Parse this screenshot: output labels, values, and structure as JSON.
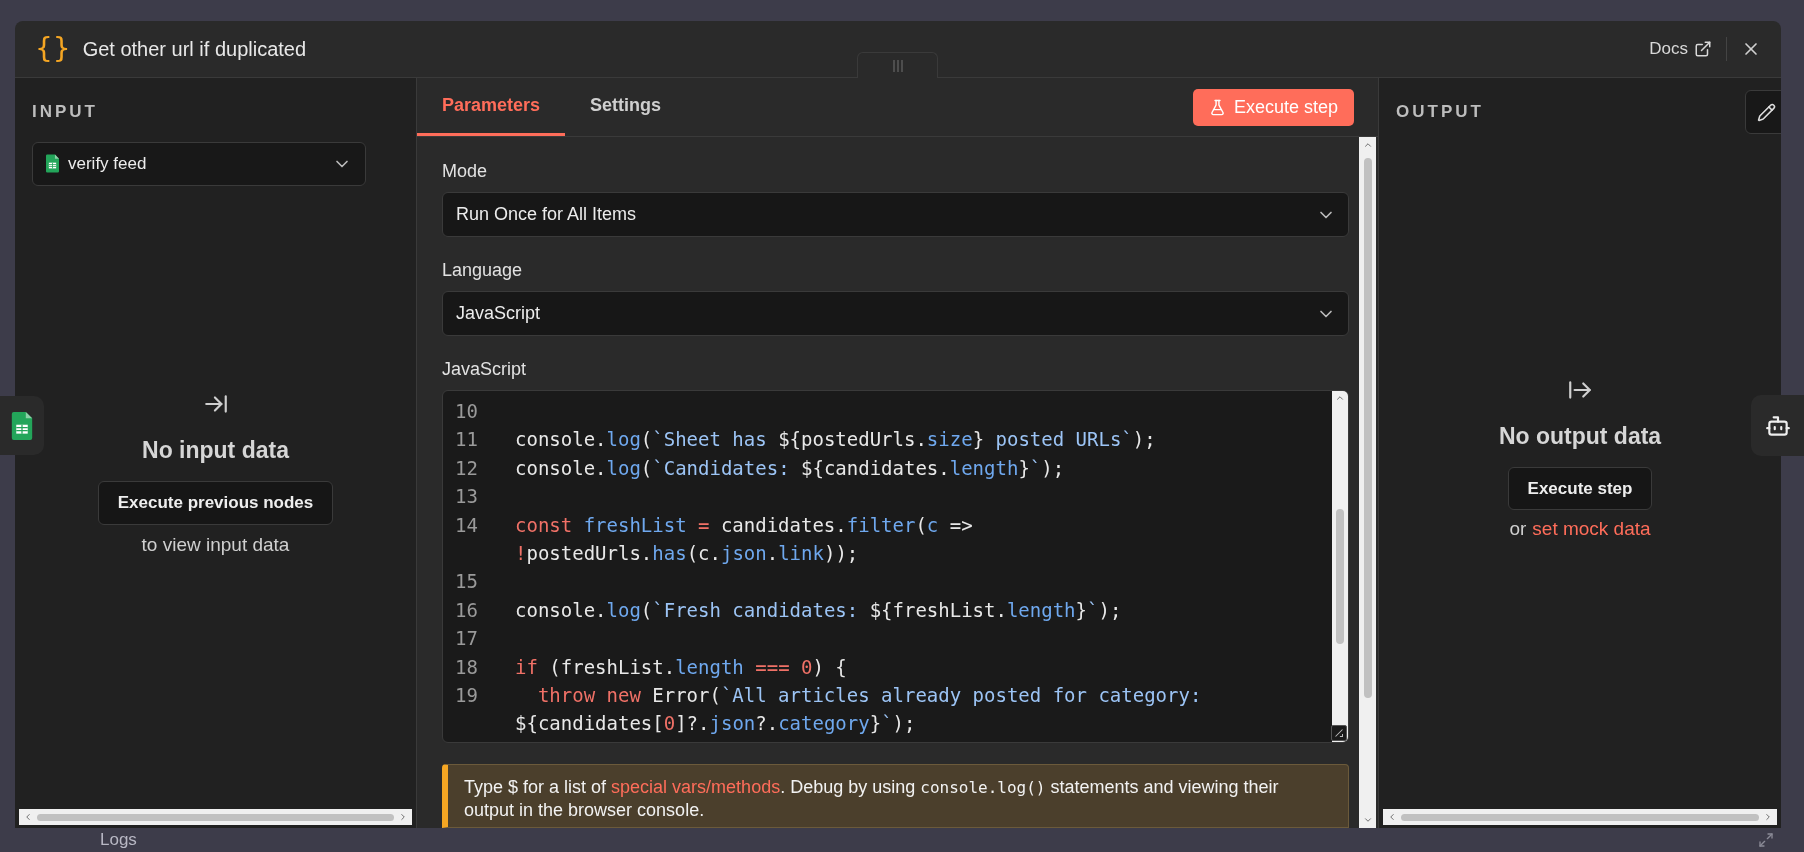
{
  "window": {
    "icon_text": "{}",
    "title": "Get other url if duplicated",
    "docs": "Docs"
  },
  "input": {
    "heading": "INPUT",
    "source": "verify feed",
    "empty_title": "No input data",
    "button": "Execute previous nodes",
    "hint": "to view input data"
  },
  "tabs": [
    {
      "label": "Parameters",
      "selected": true
    },
    {
      "label": "Settings",
      "selected": false
    }
  ],
  "execute_button": "Execute step",
  "fields": [
    {
      "label": "Mode",
      "value": "Run Once for All Items"
    },
    {
      "label": "Language",
      "value": "JavaScript"
    }
  ],
  "editor": {
    "label": "JavaScript",
    "lines": [
      {
        "number": "10"
      },
      {
        "number": "11",
        "tokens": [
          {
            "kind": "plain",
            "text": "console."
          },
          {
            "kind": "method",
            "text": "log"
          },
          {
            "kind": "plain",
            "text": "("
          },
          {
            "kind": "string",
            "text": "`Sheet has "
          },
          {
            "kind": "plain",
            "text": "${postedUrls."
          },
          {
            "kind": "method",
            "text": "size"
          },
          {
            "kind": "plain",
            "text": "}"
          },
          {
            "kind": "string",
            "text": " posted URLs`"
          },
          {
            "kind": "plain",
            "text": ");"
          }
        ]
      },
      {
        "number": "12",
        "tokens": [
          {
            "kind": "plain",
            "text": "console."
          },
          {
            "kind": "method",
            "text": "log"
          },
          {
            "kind": "plain",
            "text": "("
          },
          {
            "kind": "string",
            "text": "`Candidates: "
          },
          {
            "kind": "plain",
            "text": "${candidates."
          },
          {
            "kind": "method",
            "text": "length"
          },
          {
            "kind": "plain",
            "text": "}"
          },
          {
            "kind": "string",
            "text": "`"
          },
          {
            "kind": "plain",
            "text": ");"
          }
        ]
      },
      {
        "number": "13"
      },
      {
        "number": "14",
        "tokens": [
          {
            "kind": "keyword",
            "text": "const"
          },
          {
            "kind": "method",
            "text": " freshList"
          },
          {
            "kind": "keyword",
            "text": " ="
          },
          {
            "kind": "plain",
            "text": " candidates."
          },
          {
            "kind": "method",
            "text": "filter"
          },
          {
            "kind": "plain",
            "text": "("
          },
          {
            "kind": "method",
            "text": "c"
          },
          {
            "kind": "plain",
            "text": " => "
          },
          {
            "kind": "keyword",
            "text": "!"
          },
          {
            "kind": "plain",
            "text": "postedUrls."
          },
          {
            "kind": "method",
            "text": "has"
          },
          {
            "kind": "plain",
            "text": "(c."
          },
          {
            "kind": "method",
            "text": "json"
          },
          {
            "kind": "plain",
            "text": "."
          },
          {
            "kind": "method",
            "text": "link"
          },
          {
            "kind": "plain",
            "text": "));"
          }
        ]
      },
      {
        "number": "15"
      },
      {
        "number": "16",
        "tokens": [
          {
            "kind": "plain",
            "text": "console."
          },
          {
            "kind": "method",
            "text": "log"
          },
          {
            "kind": "plain",
            "text": "("
          },
          {
            "kind": "string",
            "text": "`Fresh candidates: "
          },
          {
            "kind": "plain",
            "text": "${freshList."
          },
          {
            "kind": "method",
            "text": "length"
          },
          {
            "kind": "plain",
            "text": "}"
          },
          {
            "kind": "string",
            "text": "`"
          },
          {
            "kind": "plain",
            "text": ");"
          }
        ]
      },
      {
        "number": "17"
      },
      {
        "number": "18",
        "tokens": [
          {
            "kind": "keyword",
            "text": "if"
          },
          {
            "kind": "plain",
            "text": " (freshList."
          },
          {
            "kind": "method",
            "text": "length"
          },
          {
            "kind": "keyword",
            "text": " === "
          },
          {
            "kind": "number",
            "text": "0"
          },
          {
            "kind": "plain",
            "text": ") {"
          }
        ]
      },
      {
        "number": "19",
        "tokens": [
          {
            "kind": "keyword",
            "text": "  throw new"
          },
          {
            "kind": "plain",
            "text": " Error("
          },
          {
            "kind": "string",
            "text": "`All articles already posted for category: "
          },
          {
            "kind": "plain",
            "text": "${candidates["
          },
          {
            "kind": "number",
            "text": "0"
          },
          {
            "kind": "plain",
            "text": "]?."
          },
          {
            "kind": "method",
            "text": "json"
          },
          {
            "kind": "plain",
            "text": "?."
          },
          {
            "kind": "method",
            "text": "category"
          },
          {
            "kind": "plain",
            "text": "}"
          },
          {
            "kind": "string",
            "text": "`"
          },
          {
            "kind": "plain",
            "text": ");"
          }
        ]
      }
    ]
  },
  "hint": {
    "before": "Type $ for a list of ",
    "link": "special vars/methods",
    "middle": ". Debug by using ",
    "code": "console.log()",
    "after": " statements and viewing their output in the browser console."
  },
  "output": {
    "heading": "OUTPUT",
    "empty_title": "No output data",
    "button": "Execute step",
    "or": "or",
    "link": "set mock data"
  },
  "logs": {
    "label": "Logs"
  }
}
